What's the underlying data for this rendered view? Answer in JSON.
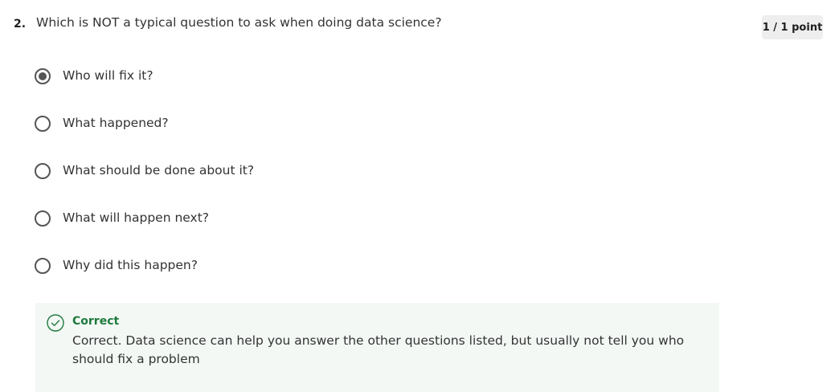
{
  "question": {
    "number": "2.",
    "text": "Which is NOT a typical question to ask when doing data science?",
    "score": "1 / 1 point"
  },
  "options": [
    {
      "label": "Who will fix it?",
      "selected": true
    },
    {
      "label": "What happened?",
      "selected": false
    },
    {
      "label": "What should be done about it?",
      "selected": false
    },
    {
      "label": "What will happen next?",
      "selected": false
    },
    {
      "label": "Why did this happen?",
      "selected": false
    }
  ],
  "feedback": {
    "status": "Correct",
    "message": "Correct. Data science can help you answer the other questions listed, but usually not tell you who should fix a problem",
    "icon": "check-circle-icon",
    "color": "#1e7a3c",
    "background": "#f3f8f5"
  }
}
